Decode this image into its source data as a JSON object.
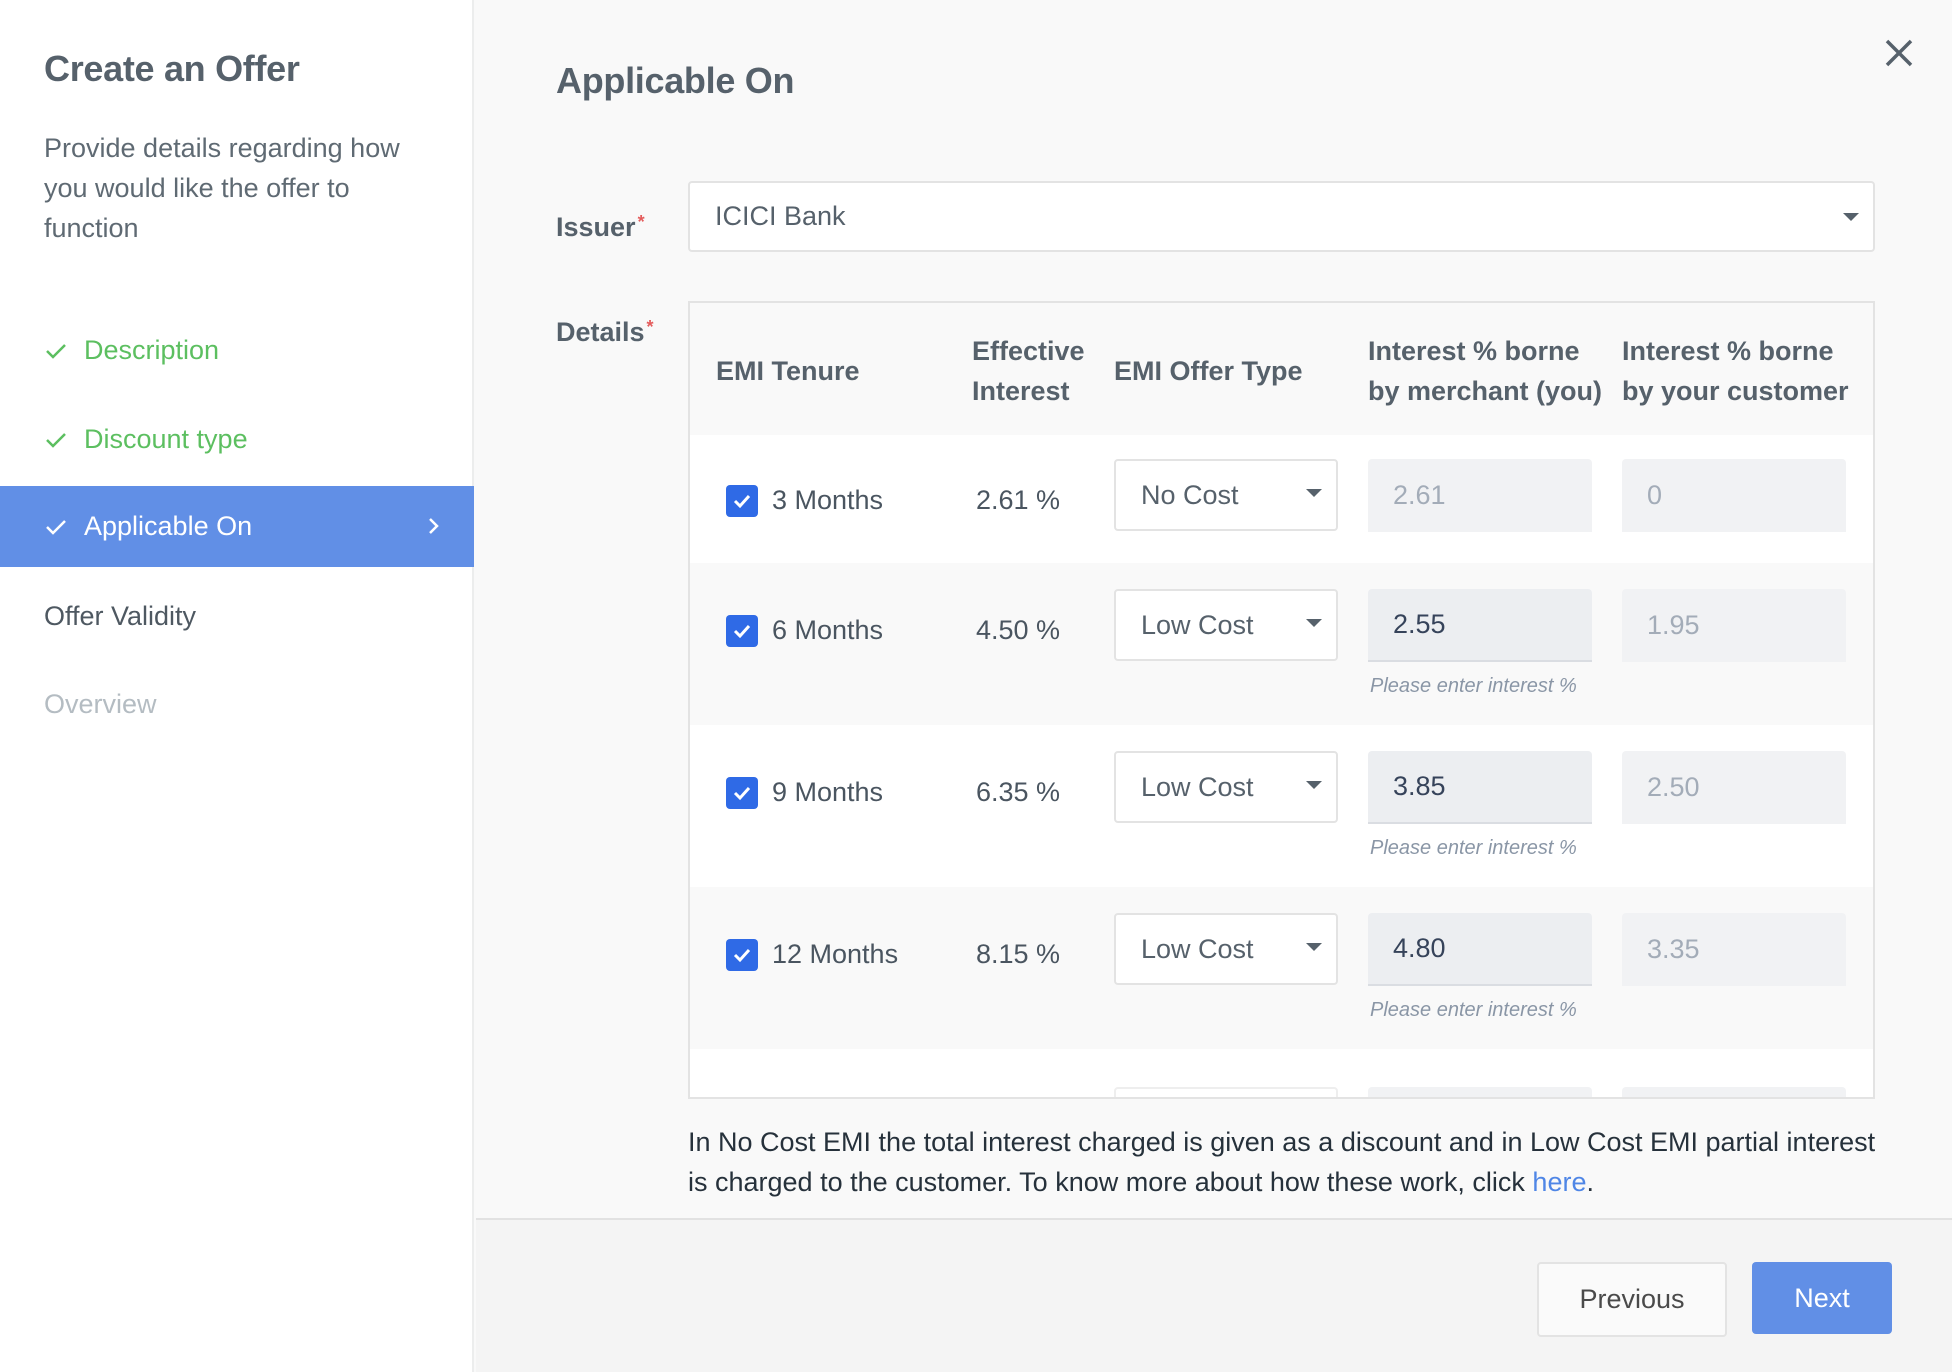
{
  "sidebar": {
    "title": "Create an Offer",
    "description": "Provide details regarding how you would like the offer to function",
    "steps": [
      {
        "label": "Description",
        "state": "done"
      },
      {
        "label": "Discount type",
        "state": "done"
      },
      {
        "label": "Applicable On",
        "state": "active"
      },
      {
        "label": "Offer Validity",
        "state": "pending"
      },
      {
        "label": "Overview",
        "state": "disabled"
      }
    ]
  },
  "main": {
    "title": "Applicable On",
    "issuer": {
      "label": "Issuer",
      "required_mark": "*",
      "value": "ICICI Bank"
    },
    "details": {
      "label": "Details",
      "required_mark": "*",
      "columns": [
        "EMI Tenure",
        "Effective Interest",
        "EMI Offer Type",
        "Interest % borne by merchant (you)",
        "Interest % borne by your customer"
      ],
      "rows": [
        {
          "checked": true,
          "tenure": "3 Months",
          "effective_interest": "2.61 %",
          "offer_type": "No Cost",
          "merchant_interest": "2.61",
          "customer_interest": "0",
          "hint": ""
        },
        {
          "checked": true,
          "tenure": "6 Months",
          "effective_interest": "4.50 %",
          "offer_type": "Low Cost",
          "merchant_interest": "2.55",
          "customer_interest": "1.95",
          "hint": "Please enter interest %"
        },
        {
          "checked": true,
          "tenure": "9 Months",
          "effective_interest": "6.35 %",
          "offer_type": "Low Cost",
          "merchant_interest": "3.85",
          "customer_interest": "2.50",
          "hint": "Please enter interest %"
        },
        {
          "checked": true,
          "tenure": "12 Months",
          "effective_interest": "8.15 %",
          "offer_type": "Low Cost",
          "merchant_interest": "4.80",
          "customer_interest": "3.35",
          "hint": "Please enter interest %"
        }
      ]
    },
    "info": {
      "text": "In No Cost EMI the total interest charged is given as a discount and in Low Cost EMI partial interest is charged to the customer. To know more about how these work, click ",
      "link_text": "here",
      "suffix": "."
    }
  },
  "footer": {
    "previous_label": "Previous",
    "next_label": "Next"
  },
  "colors": {
    "accent": "#618fe6",
    "checkbox": "#2f6ae6",
    "done": "#5cbf60",
    "required": "#e45b5b",
    "link": "#4f86e6"
  },
  "icons": {
    "close": "close-icon",
    "check": "check-icon",
    "chevron": "chevron-right-icon",
    "caret": "caret-down-icon"
  }
}
